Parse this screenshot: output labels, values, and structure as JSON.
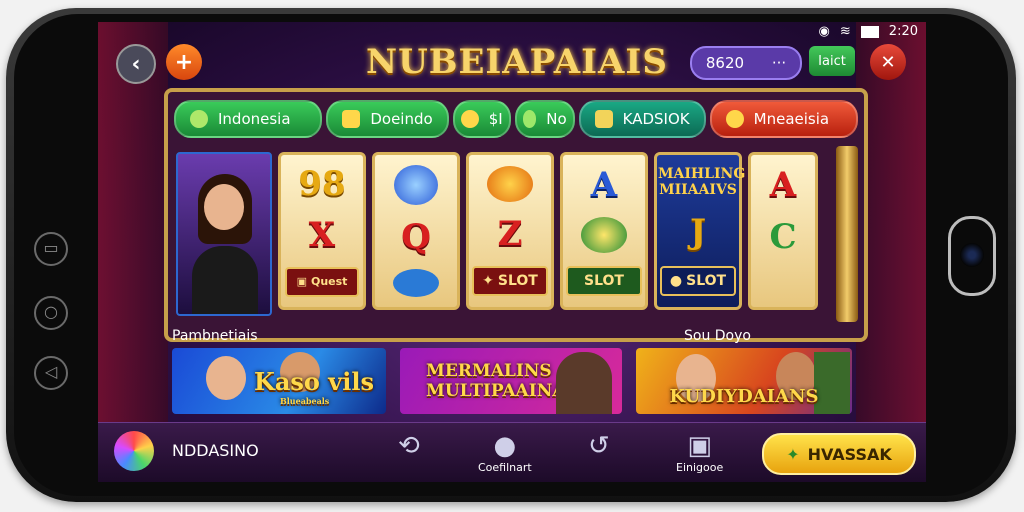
{
  "status": {
    "time": "2:20",
    "icons": [
      "location-icon",
      "wifi-icon",
      "battery-icon"
    ]
  },
  "header": {
    "back_icon": "back-icon",
    "add_icon": "plus-icon",
    "logo_text": "NUBEIAPAIAIS",
    "balance": "8620",
    "balance_more": "···",
    "green_button": "Iaict",
    "close_icon": "tools-icon"
  },
  "tabs": [
    {
      "label": "Indonesia",
      "icon": "leaf-icon",
      "color": "#2aa84a"
    },
    {
      "label": "Doeindo",
      "icon": "briefcase-icon",
      "color": "#2aa84a"
    },
    {
      "label": "$I",
      "icon": "coin-icon",
      "color": "#2aa84a"
    },
    {
      "label": "No",
      "icon": "badge-icon",
      "color": "#2aa84a"
    },
    {
      "label": "KADSIOK",
      "icon": "cube-icon",
      "color": "#0d8a6a"
    },
    {
      "label": "Mneaeisia",
      "icon": "coin-icon",
      "color": "#d8432a"
    }
  ],
  "reels": [
    {
      "symbols": [
        "98",
        "X"
      ],
      "button": "",
      "badge": "Quest"
    },
    {
      "symbols": [
        "Q"
      ],
      "button": "",
      "top": "globe"
    },
    {
      "symbols": [
        "Z"
      ],
      "button": "SLOT"
    },
    {
      "symbols": [
        "A"
      ],
      "button": "SLOT"
    },
    {
      "symbols": [
        "MAIHLING MIIAAIVS",
        "J"
      ],
      "button": "SLOT"
    },
    {
      "symbols": [
        "A",
        "C"
      ],
      "button": ""
    }
  ],
  "sections": {
    "left": "Pambnetiais",
    "right": "Sou Doyo"
  },
  "banners": [
    {
      "title": "Kaso vils",
      "subtitle": "Blueabeals"
    },
    {
      "title": "MERMALINS MULTIPAAINAN",
      "subtitle": ""
    },
    {
      "title": "KUDIYDAIANS",
      "subtitle": ""
    }
  ],
  "bottom_nav": {
    "app_name": "NDDASINO",
    "items": [
      {
        "label": "",
        "icon": "refresh-icon"
      },
      {
        "label": "Coefilnart",
        "icon": "chat-icon"
      },
      {
        "label": "",
        "icon": "undo-icon"
      },
      {
        "label": "Einigooe",
        "icon": "gift-icon"
      }
    ],
    "cta": "HVASSAK"
  }
}
